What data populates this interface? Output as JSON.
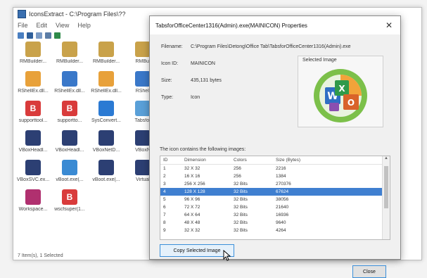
{
  "explorer": {
    "title": "IconsExtract - C:\\Program Files\\??",
    "menu": [
      "File",
      "Edit",
      "View",
      "Help"
    ],
    "status": "7 Item(s), 1 Selected",
    "items": [
      {
        "label": "RMBuilder...",
        "icon": "rmbuilder-icon",
        "color": "#c9a24a",
        "glyph": ""
      },
      {
        "label": "RMBuilder...",
        "icon": "rmbuilder-icon",
        "color": "#c9a24a",
        "glyph": ""
      },
      {
        "label": "RMBuilder...",
        "icon": "rmbuilder-icon",
        "color": "#c9a24a",
        "glyph": ""
      },
      {
        "label": "RMBui",
        "icon": "rmbuilder-icon",
        "color": "#c9a24a",
        "glyph": ""
      },
      {
        "label": "RShellEx.dll...",
        "icon": "shell-ext-icon",
        "color": "#e8a13a",
        "glyph": ""
      },
      {
        "label": "RShellEx.dll...",
        "icon": "shell-ext-icon",
        "color": "#3a78c9",
        "glyph": ""
      },
      {
        "label": "RShellEx.dll...",
        "icon": "shell-ext-icon",
        "color": "#e8a13a",
        "glyph": ""
      },
      {
        "label": "RShell",
        "icon": "shell-ext-icon",
        "color": "#3a78c9",
        "glyph": ""
      },
      {
        "label": "supporttool...",
        "icon": "b-app-icon",
        "color": "#d93b3b",
        "glyph": "B"
      },
      {
        "label": "supportto...",
        "icon": "b-app-icon",
        "color": "#d93b3b",
        "glyph": "B"
      },
      {
        "label": "SysConvert...",
        "icon": "intel-icon",
        "color": "#2b7ad3",
        "glyph": ""
      },
      {
        "label": "Tabsfor",
        "icon": "globe-icon",
        "color": "#5aa0d8",
        "glyph": ""
      },
      {
        "label": "VBoxHeadl...",
        "icon": "virtualbox-icon",
        "color": "#2c3f73",
        "glyph": ""
      },
      {
        "label": "VBoxHeadl...",
        "icon": "virtualbox-icon",
        "color": "#2c3f73",
        "glyph": ""
      },
      {
        "label": "VBoxNetD...",
        "icon": "virtualbox-icon",
        "color": "#2c3f73",
        "glyph": ""
      },
      {
        "label": "VBoxN",
        "icon": "virtualbox-icon",
        "color": "#2c3f73",
        "glyph": ""
      },
      {
        "label": "VBoxSVC.ex...",
        "icon": "virtualbox-icon",
        "color": "#2c3f73",
        "glyph": ""
      },
      {
        "label": "vBoot.exe(...",
        "icon": "display-icon",
        "color": "#3a8ad3",
        "glyph": ""
      },
      {
        "label": "vBoot.exe(...",
        "icon": "virtualbox-icon",
        "color": "#2c3f73",
        "glyph": ""
      },
      {
        "label": "Virtual",
        "icon": "virtualbox-icon",
        "color": "#2c3f73",
        "glyph": ""
      },
      {
        "label": "Workspace...",
        "icon": "workspace-icon",
        "color": "#b0306f",
        "glyph": ""
      },
      {
        "label": "wscfsuper(1...",
        "icon": "b-app-icon",
        "color": "#d93b3b",
        "glyph": "B"
      }
    ]
  },
  "dialog": {
    "title": "TabsforOfficeCenter1316(Admin).exe(MAINICON) Properties",
    "filename_label": "Filename:",
    "filename_value": "C:\\Program Files\\Detong\\Office Tab\\TabsforOfficeCenter1316(Admin).exe",
    "icon_id_label": "Icon ID:",
    "icon_id_value": "MAINICON",
    "size_label": "Size:",
    "size_value": "435,131 bytes",
    "type_label": "Type:",
    "type_value": "Icon",
    "selected_image_caption": "Selected Image",
    "contains_text": "The icon contains the following images:",
    "table_headers": [
      "ID",
      "Dimension",
      "Colors",
      "Size (Bytes)"
    ],
    "table_rows": [
      [
        "1",
        "32 X 32",
        "256",
        "2216"
      ],
      [
        "2",
        "16 X 16",
        "256",
        "1384"
      ],
      [
        "3",
        "256 X 256",
        "32 Bits",
        "270376"
      ],
      [
        "4",
        "128 X 128",
        "32 Bits",
        "67624"
      ],
      [
        "5",
        "96 X 96",
        "32 Bits",
        "38056"
      ],
      [
        "6",
        "72 X 72",
        "32 Bits",
        "21640"
      ],
      [
        "7",
        "64 X 64",
        "32 Bits",
        "16936"
      ],
      [
        "8",
        "48 X 48",
        "32 Bits",
        "9640"
      ],
      [
        "9",
        "32 X 32",
        "32 Bits",
        "4264"
      ]
    ],
    "selected_row_index": 3,
    "copy_button": "Copy Selected Image",
    "close_button": "Close",
    "close_glyph": "✕"
  },
  "colors": {
    "selection": "#3f7fd0",
    "accent_border": "#3b8fd9"
  }
}
